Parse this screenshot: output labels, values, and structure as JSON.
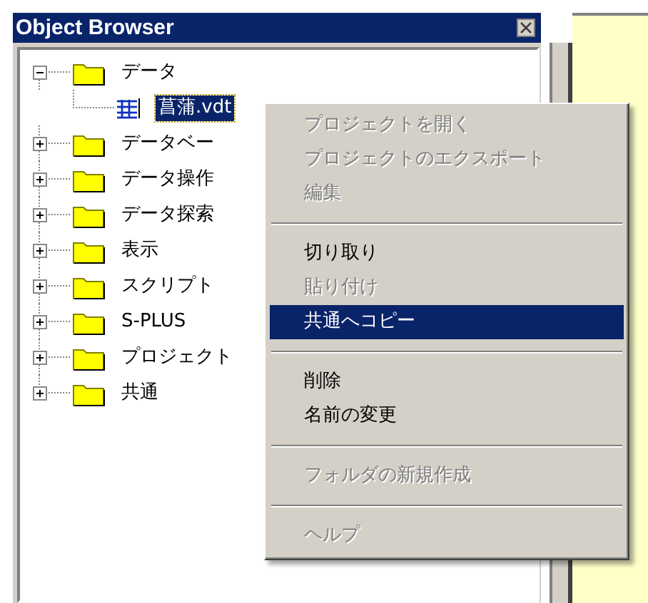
{
  "panel": {
    "title": "Object Browser"
  },
  "tree": [
    {
      "kind": "folder",
      "label": "データ",
      "expanded": true,
      "selected": false,
      "children": [
        {
          "kind": "table",
          "label": "菖蒲.vdt",
          "selected": true
        }
      ]
    },
    {
      "kind": "folder",
      "label": "データベー",
      "expanded": false,
      "selected": false
    },
    {
      "kind": "folder",
      "label": "データ操作",
      "expanded": false,
      "selected": false
    },
    {
      "kind": "folder",
      "label": "データ探索",
      "expanded": false,
      "selected": false
    },
    {
      "kind": "folder",
      "label": "表示",
      "expanded": false,
      "selected": false
    },
    {
      "kind": "folder",
      "label": "スクリプト",
      "expanded": false,
      "selected": false
    },
    {
      "kind": "folder",
      "label": "S-PLUS",
      "expanded": false,
      "selected": false
    },
    {
      "kind": "folder",
      "label": "プロジェクト",
      "expanded": false,
      "selected": false
    },
    {
      "kind": "folder",
      "label": "共通",
      "expanded": false,
      "selected": false
    }
  ],
  "context_menu": {
    "items": [
      {
        "kind": "item",
        "label": "プロジェクトを開く",
        "disabled": true,
        "selected": false
      },
      {
        "kind": "item",
        "label": "プロジェクトのエクスポート",
        "disabled": true,
        "selected": false
      },
      {
        "kind": "item",
        "label": "編集",
        "disabled": true,
        "selected": false
      },
      {
        "kind": "separator"
      },
      {
        "kind": "item",
        "label": "切り取り",
        "disabled": false,
        "selected": false
      },
      {
        "kind": "item",
        "label": "貼り付け",
        "disabled": true,
        "selected": false
      },
      {
        "kind": "item",
        "label": "共通へコピー",
        "disabled": false,
        "selected": true
      },
      {
        "kind": "separator"
      },
      {
        "kind": "item",
        "label": "削除",
        "disabled": false,
        "selected": false
      },
      {
        "kind": "item",
        "label": "名前の変更",
        "disabled": false,
        "selected": false
      },
      {
        "kind": "separator"
      },
      {
        "kind": "item",
        "label": "フォルダの新規作成",
        "disabled": true,
        "selected": false
      },
      {
        "kind": "separator"
      },
      {
        "kind": "item",
        "label": "ヘルプ",
        "disabled": true,
        "selected": false
      }
    ]
  }
}
